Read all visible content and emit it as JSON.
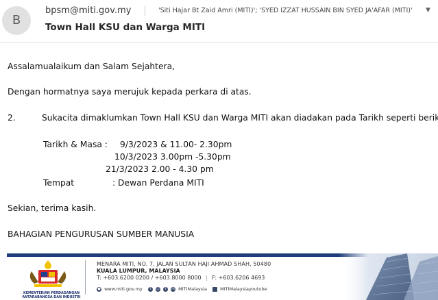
{
  "header": {
    "avatar_initial": "B",
    "sender": "bpsm@miti.gov.my",
    "recipients": "'Siti Hajar Bt Zaid Amri (MITI)'; 'SYED IZZAT HUSSAIN BIN SYED JA'AFAR (MITI)'",
    "subject": "Town Hall KSU dan Warga MITI"
  },
  "body": {
    "greeting": "Assalamualaikum dan Salam Sejahtera,",
    "intro": "Dengan hormatnya saya merujuk kepada perkara di atas.",
    "item_number": "2.",
    "item_text": "Sukacita dimaklumkan Town Hall KSU dan Warga MITI akan diadakan pada Tarikh seperti berikut:",
    "date_label": "Tarikh & Masa :",
    "date_1": "9/3/2023 &  11.00- 2.30pm",
    "date_2": "10/3/2023 3.00pm -5.30pm",
    "date_3": "21/3/2023 2.00 - 4.30 pm",
    "venue_label": "Tempat",
    "venue_value": ": Dewan Perdana MITI",
    "closing": "Sekian, terima kasih.",
    "department": "BAHAGIAN PENGURUSAN SUMBER MANUSIA"
  },
  "footer": {
    "logo_text": "KEMENTERIAN PERDAGANGAN ANTARABANGSA DAN INDUSTRI",
    "address_line1": "MENARA MITI, NO. 7, JALAN SULTAN HAJI AHMAD SHAH, 50480",
    "address_line2": "KUALA LUMPUR, MALAYSIA",
    "phone": "T: +603.6200 0200 / +603.8000 8000",
    "fax": "F: +603.6206 4693",
    "website": "www.miti.gov.my",
    "social_handle": "MITIMalaysia",
    "youtube_handle": "MITIMalaysiayoutube"
  },
  "colors": {
    "accent": "#1f3d7a",
    "avatar_bg": "#e1e1e1"
  }
}
